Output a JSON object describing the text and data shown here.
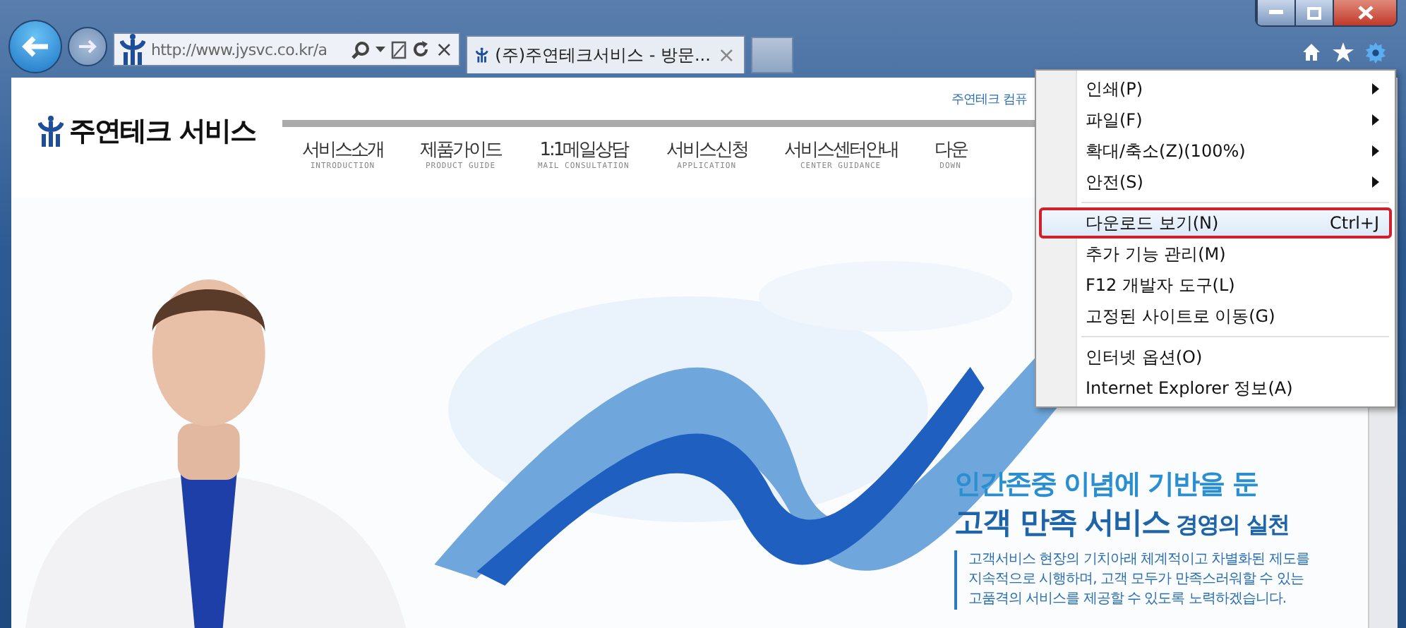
{
  "browser": {
    "back_disabled": false,
    "forward_disabled": true,
    "address": "http://www.jysvc.co.kr/a",
    "tab": {
      "title": "(주)주연테크서비스 - 방문...",
      "close": "×",
      "selected": true
    },
    "stop": "×"
  },
  "site": {
    "logo": "주연테크 서비스",
    "top_link": "주연테크 컴퓨",
    "nav": [
      {
        "label": "서비스소개",
        "sub": "INTRODUCTION"
      },
      {
        "label": "제품가이드",
        "sub": "PRODUCT GUIDE"
      },
      {
        "label": "1:1메일상담",
        "sub": "MAIL CONSULTATION"
      },
      {
        "label": "서비스신청",
        "sub": "APPLICATION"
      },
      {
        "label": "서비스센터안내",
        "sub": "CENTER GUIDANCE"
      },
      {
        "label": "다운",
        "sub": "DOWN"
      }
    ],
    "hero": {
      "line_1": "인간존중 이념에 기반을 둔",
      "line_2": "**고객 만족 서비스** 경영의 실천",
      "paragraph_lines": [
        "고객서비스 현장의 기치아래 체계적이고 차별화된 제도를",
        "지속적으로 시행하며, 고객 모두가 만족스러워할 수 있는",
        "고품격의 서비스를 제공할 수 있도록 노력하겠습니다."
      ]
    }
  },
  "tools_menu": [
    {
      "kind": "item",
      "label": "인쇄(P)",
      "submenu": true,
      "selected": false
    },
    {
      "kind": "item",
      "label": "파일(F)",
      "submenu": true,
      "selected": false
    },
    {
      "kind": "item",
      "label": "확대/축소(Z)(100%)",
      "submenu": true,
      "selected": false
    },
    {
      "kind": "item",
      "label": "안전(S)",
      "submenu": true,
      "selected": false
    },
    {
      "kind": "separator"
    },
    {
      "kind": "item",
      "label": "다운로드 보기(N)",
      "shortcut": "Ctrl+J",
      "submenu": false,
      "selected": true,
      "outlined": true
    },
    {
      "kind": "item",
      "label": "추가 기능 관리(M)",
      "submenu": false,
      "selected": false
    },
    {
      "kind": "item",
      "label": "F12 개발자 도구(L)",
      "submenu": false,
      "selected": false
    },
    {
      "kind": "item",
      "label": "고정된 사이트로 이동(G)",
      "submenu": false,
      "selected": false
    },
    {
      "kind": "separator"
    },
    {
      "kind": "item",
      "label": "인터넷 옵션(O)",
      "submenu": false,
      "selected": false
    },
    {
      "kind": "item",
      "label": "Internet Explorer 정보(A)",
      "submenu": false,
      "selected": false
    }
  ]
}
